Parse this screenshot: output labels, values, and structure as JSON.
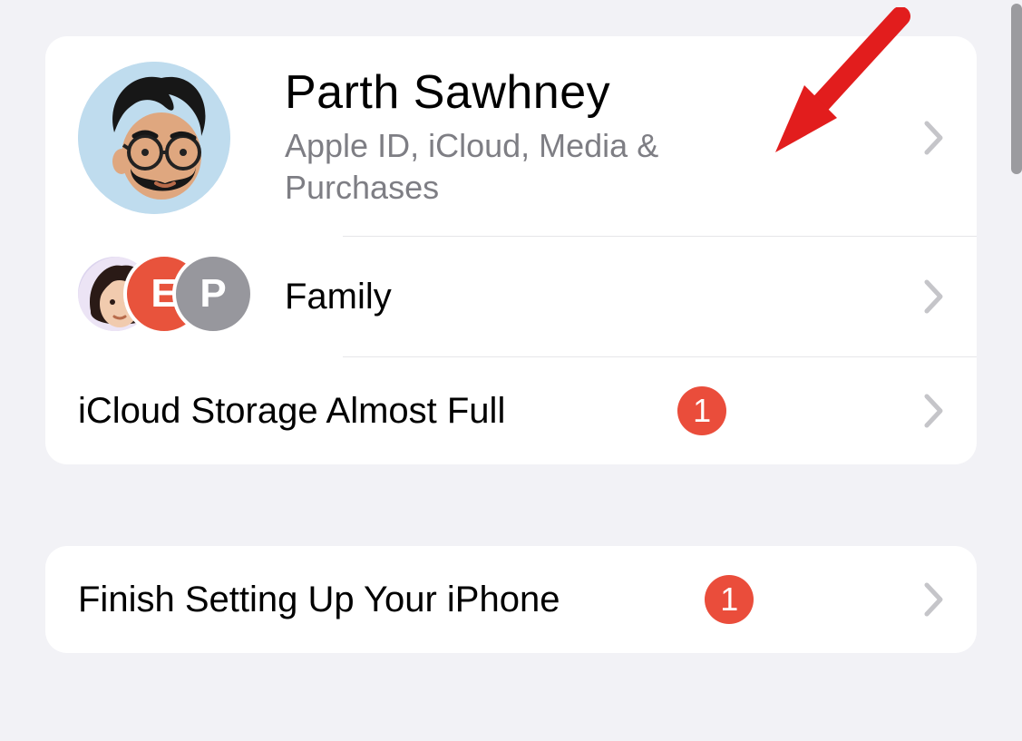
{
  "profile": {
    "name": "Parth Sawhney",
    "subtitle": "Apple ID, iCloud, Media & Purchases"
  },
  "family": {
    "label": "Family",
    "avatars": [
      {
        "type": "memoji"
      },
      {
        "type": "initial",
        "initial": "E",
        "bg": "#e8533c"
      },
      {
        "type": "initial",
        "initial": "P",
        "bg": "#97979d"
      }
    ]
  },
  "icloud_warning": {
    "label": "iCloud Storage Almost Full",
    "badge": "1"
  },
  "setup": {
    "label": "Finish Setting Up Your iPhone",
    "badge": "1"
  },
  "colors": {
    "badge_bg": "#ea4d3b",
    "page_bg": "#f2f2f6",
    "card_bg": "#ffffff",
    "subtitle": "#7e7e84"
  }
}
